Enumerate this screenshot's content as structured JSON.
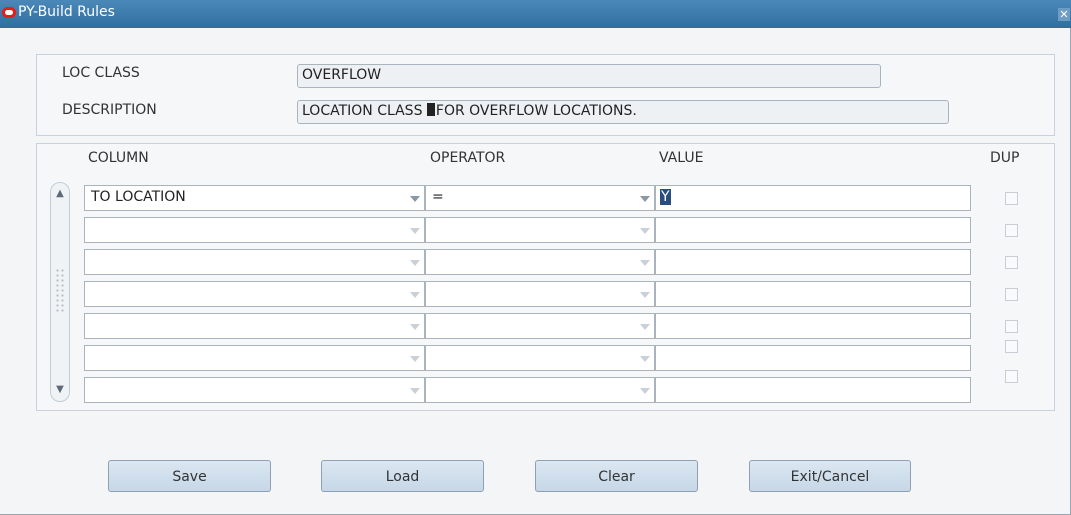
{
  "window": {
    "title": "PY-Build Rules",
    "close_glyph": "✕"
  },
  "header": {
    "loc_class_label": "LOC CLASS",
    "loc_class_value": "OVERFLOW",
    "description_label": "DESCRIPTION",
    "description_value_before_cursor": "LOCATION CLASS ",
    "description_value_after_cursor": "FOR OVERFLOW LOCATIONS."
  },
  "grid": {
    "columns": {
      "column": "COLUMN",
      "operator": "OPERATOR",
      "value": "VALUE",
      "dup": "DUP"
    },
    "rows": [
      {
        "column": "TO LOCATION",
        "operator": "=",
        "value": "Y",
        "dup": false
      },
      {
        "column": "",
        "operator": "",
        "value": "",
        "dup": false
      },
      {
        "column": "",
        "operator": "",
        "value": "",
        "dup": false
      },
      {
        "column": "",
        "operator": "",
        "value": "",
        "dup": false
      },
      {
        "column": "",
        "operator": "",
        "value": "",
        "dup": false
      },
      {
        "column": "",
        "operator": "",
        "value": "",
        "dup": false
      },
      {
        "column": "",
        "operator": "",
        "value": "",
        "dup": false
      }
    ]
  },
  "buttons": {
    "save": "Save",
    "load": "Load",
    "clear": "Clear",
    "exit": "Exit/Cancel"
  },
  "icons": {
    "scroll_up": "▲",
    "scroll_down": "▼"
  },
  "colors": {
    "titlebar": "#3a7cae",
    "oracle_red": "#e0201b",
    "button_blue": "#cfdeec"
  }
}
